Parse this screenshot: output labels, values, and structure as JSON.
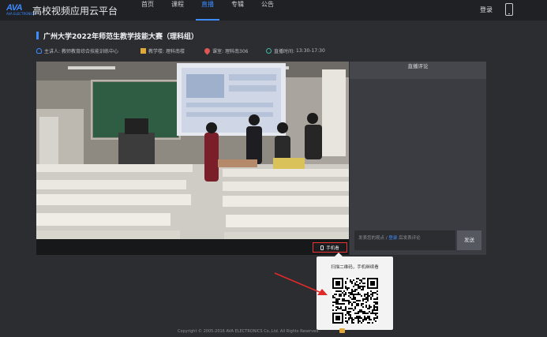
{
  "brand": {
    "logo_text": "AVA",
    "logo_sub": "AVA ELECTRONICS",
    "site_title": "高校视频应用云平台"
  },
  "nav": {
    "items": [
      "首页",
      "课程",
      "直播",
      "专辑",
      "公告"
    ],
    "active_index": 2
  },
  "header": {
    "login": "登录"
  },
  "page": {
    "title": "广州大学2022年师范生教学技能大赛（理科组）"
  },
  "meta": {
    "lecturer_label": "主讲人:",
    "lecturer_value": "教师教育综合技能训练中心",
    "building_label": "教学楼:",
    "building_value": "理科南楼",
    "room_label": "课室:",
    "room_value": "理科南306",
    "time_label": "直播时间:",
    "time_value": "13:30-17:30"
  },
  "player": {
    "mobile_button": "手机看"
  },
  "comments": {
    "header": "直播评论",
    "input_prefix": "发表您的观点 / ",
    "input_link": "登录",
    "input_suffix": " 后发表评论",
    "send": "发送"
  },
  "qr": {
    "title": "扫描二维码，手机继续看"
  },
  "footer": {
    "copyright": "Copyright © 2005-2016 AVA ELECTRONICS Co.,Ltd. All Rights Reserved."
  },
  "colors": {
    "accent": "#3d8bff",
    "background": "#2b2d31",
    "header": "#1f2125",
    "highlight": "#e33333"
  }
}
